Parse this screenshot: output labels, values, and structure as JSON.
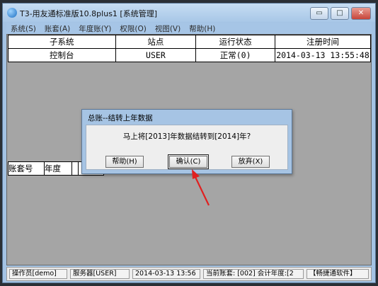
{
  "window": {
    "title": "T3-用友通标准版10.8plus1 [系统管理]",
    "min_glyph": "▭",
    "max_glyph": "□",
    "close_glyph": "✕"
  },
  "menu": [
    "系统(S)",
    "账套(A)",
    "年度账(Y)",
    "权限(O)",
    "视图(V)",
    "帮助(H)"
  ],
  "subsystems_table": {
    "headers": [
      "子系统",
      "站点",
      "运行状态",
      "注册时间"
    ],
    "rows": [
      [
        "控制台",
        "USER",
        "正常(0)",
        "2014-03-13 13:55:48"
      ]
    ]
  },
  "account_table": {
    "headers": [
      "账套号",
      "年度"
    ]
  },
  "dialog": {
    "title": "总账--结转上年数据",
    "message": "马上将[2013]年数据结转到[2014]年?",
    "help_label": "帮助(H)",
    "confirm_label": "确认(C)",
    "abandon_label": "放弃(X)"
  },
  "statusbar": {
    "operator": "操作员[demo]",
    "server": "服务器[USER]",
    "datetime": "2014-03-13 13:56",
    "current_account": "当前账套: [002] 会计年度:[2",
    "brand": "【畅捷通软件】"
  },
  "colors": {
    "title_bar": "#a8c7e7",
    "client_bg": "#a5a5a5",
    "annotation_arrow": "#e02020"
  }
}
